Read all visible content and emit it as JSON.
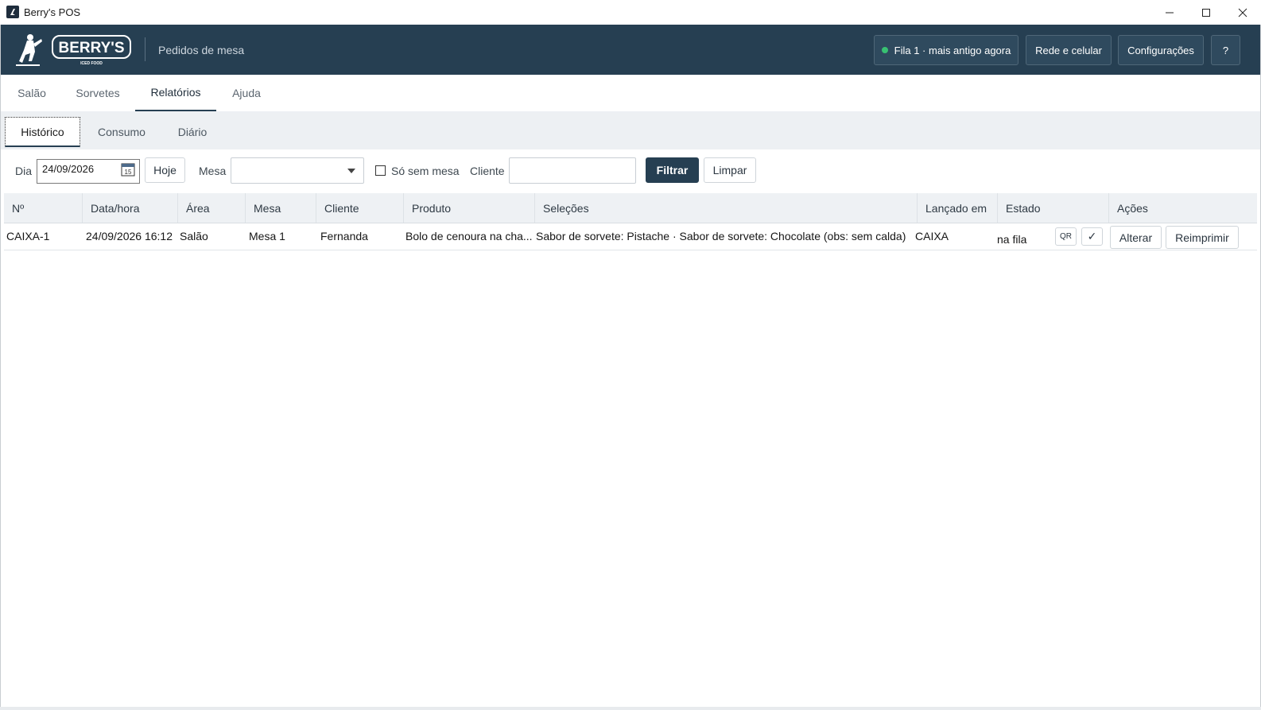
{
  "window": {
    "title": "Berry's POS"
  },
  "header": {
    "logo_text": "BERRY'S",
    "logo_sub": "ICED FOOD",
    "title": "Pedidos de mesa",
    "queue_label": "Fila 1 · mais antigo agora",
    "network_label": "Rede e celular",
    "config_label": "Configurações",
    "help_label": "?"
  },
  "main_tabs": [
    "Salão",
    "Sorvetes",
    "Relatórios",
    "Ajuda"
  ],
  "sub_tabs": [
    "Histórico",
    "Consumo",
    "Diário"
  ],
  "filters": {
    "day_label": "Dia",
    "day_value": "24/09/2026",
    "calendar_day": "15",
    "today_button": "Hoje",
    "table_label": "Mesa",
    "no_table_label": "Só sem mesa",
    "client_label": "Cliente",
    "filter_button": "Filtrar",
    "clear_button": "Limpar"
  },
  "table": {
    "headers": [
      "Nº",
      "Data/hora",
      "Área",
      "Mesa",
      "Cliente",
      "Produto",
      "Seleções",
      "Lançado em",
      "Estado",
      "Ações"
    ],
    "rows": [
      {
        "num": "CAIXA-1",
        "datetime": "24/09/2026 16:12",
        "area": "Salão",
        "table": "Mesa 1",
        "client": "Fernanda",
        "product": "Bolo de cenoura na cha...",
        "selections": "Sabor de sorvete: Pistache · Sabor de sorvete: Chocolate (obs: sem calda)",
        "launched_in": "CAIXA",
        "status": "na fila",
        "qr_label": "QR",
        "check_label": "✓",
        "edit_label": "Alterar",
        "reprint_label": "Reimprimir"
      }
    ]
  },
  "colors": {
    "header_bg": "#263f52",
    "accent": "#263f52",
    "queue_dot": "#38c172"
  }
}
